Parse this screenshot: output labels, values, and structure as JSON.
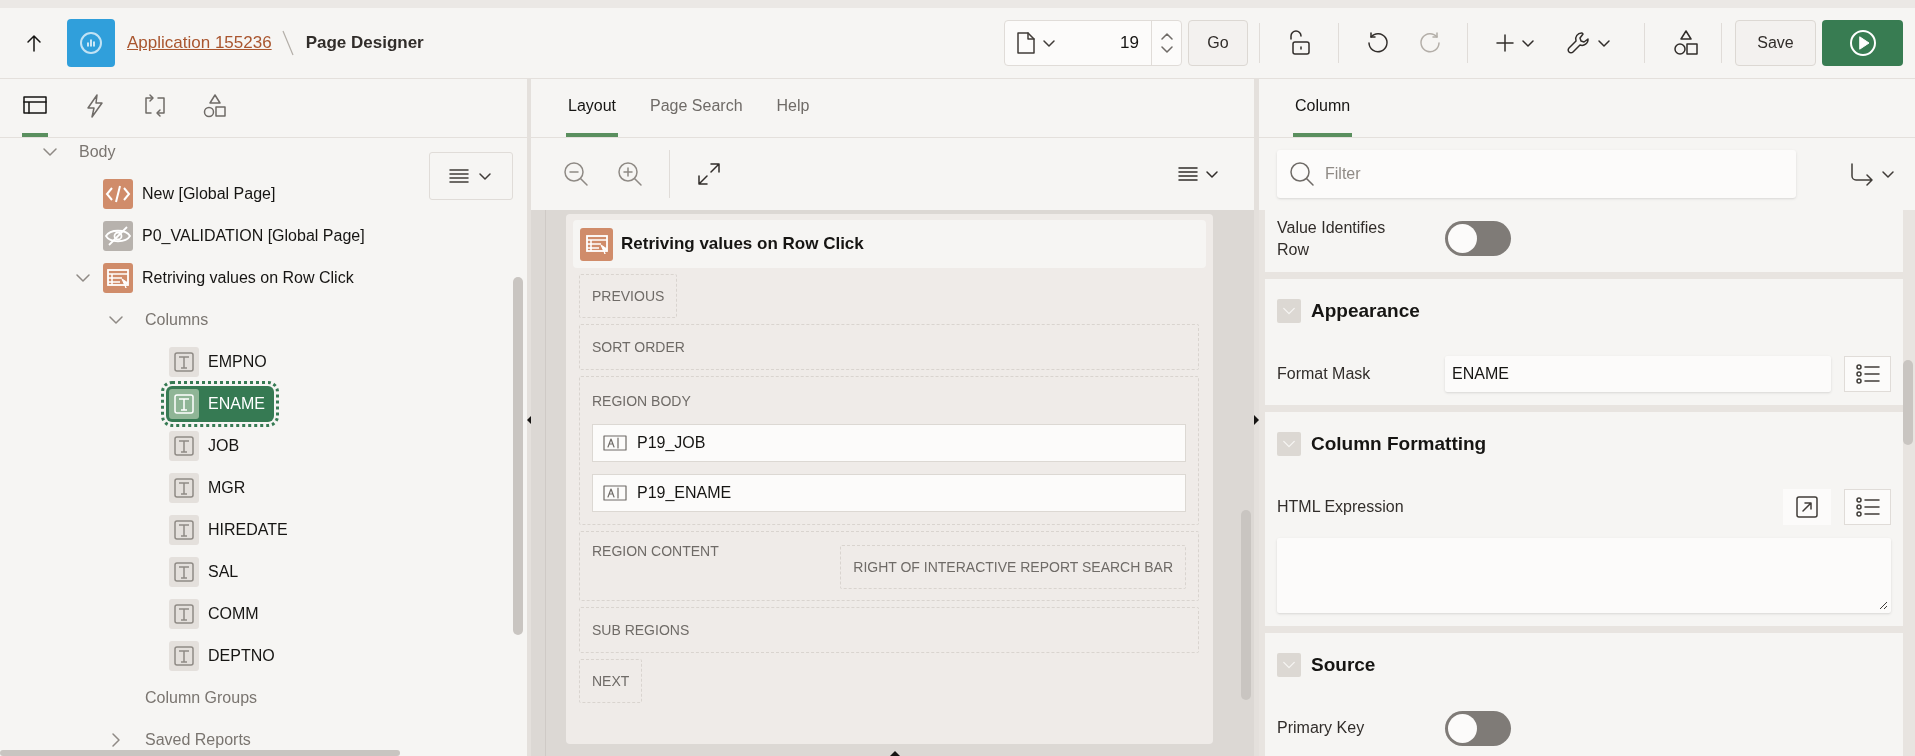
{
  "header": {
    "app_link": "Application 155236",
    "title": "Page Designer",
    "page_number": "19",
    "go_button": "Go",
    "save_button": "Save"
  },
  "left_panel": {
    "tabs": [
      {
        "kind": "rendering",
        "selected": true
      },
      {
        "kind": "dynamic-actions",
        "selected": false
      },
      {
        "kind": "processing",
        "selected": false
      },
      {
        "kind": "shared",
        "selected": false
      }
    ],
    "tree": [
      {
        "label": "Body",
        "expanded": true,
        "children": [
          {
            "label": "New [Global Page]",
            "kind": "code"
          },
          {
            "label": "P0_VALIDATION [Global Page]",
            "kind": "hidden"
          },
          {
            "label": "Retriving values on Row Click",
            "kind": "report",
            "expanded": true,
            "children": [
              {
                "label": "Columns",
                "expanded": true,
                "children": [
                  {
                    "label": "EMPNO",
                    "kind": "column",
                    "selected": false
                  },
                  {
                    "label": "ENAME",
                    "kind": "column",
                    "selected": true
                  },
                  {
                    "label": "JOB",
                    "kind": "column",
                    "selected": false
                  },
                  {
                    "label": "MGR",
                    "kind": "column",
                    "selected": false
                  },
                  {
                    "label": "HIREDATE",
                    "kind": "column",
                    "selected": false
                  },
                  {
                    "label": "SAL",
                    "kind": "column",
                    "selected": false
                  },
                  {
                    "label": "COMM",
                    "kind": "column",
                    "selected": false
                  },
                  {
                    "label": "DEPTNO",
                    "kind": "column",
                    "selected": false
                  }
                ]
              },
              {
                "label": "Column Groups"
              },
              {
                "label": "Saved Reports",
                "expanded": false
              }
            ]
          }
        ]
      }
    ]
  },
  "layout_panel": {
    "tabs": [
      {
        "label": "Layout",
        "selected": true
      },
      {
        "label": "Page Search",
        "selected": false
      },
      {
        "label": "Help",
        "selected": false
      }
    ],
    "region": {
      "title": "Retriving values on Row Click",
      "slots": [
        {
          "label": "PREVIOUS",
          "kind": "compact"
        },
        {
          "label": "SORT ORDER",
          "kind": "row"
        },
        {
          "label": "REGION BODY",
          "kind": "row",
          "items": [
            "P19_JOB",
            "P19_ENAME"
          ]
        },
        {
          "label": "REGION CONTENT",
          "kind": "row",
          "position": "RIGHT OF INTERACTIVE REPORT SEARCH BAR"
        },
        {
          "label": "SUB REGIONS",
          "kind": "row"
        },
        {
          "label": "NEXT",
          "kind": "compact"
        }
      ]
    }
  },
  "property_panel": {
    "tabs": [
      {
        "label": "Column",
        "selected": true
      }
    ],
    "filter": {
      "placeholder": "Filter"
    },
    "groups": [
      {
        "properties": [
          {
            "kind": "toggle",
            "label": "Value Identifies Row",
            "on": false
          }
        ]
      },
      {
        "title": "Appearance",
        "expanded": true,
        "properties": [
          {
            "kind": "text",
            "label": "Format Mask",
            "value": "ENAME"
          }
        ]
      },
      {
        "title": "Column Formatting",
        "expanded": true,
        "properties": [
          {
            "kind": "textarea",
            "label": "HTML Expression"
          }
        ]
      },
      {
        "title": "Source",
        "expanded": true,
        "properties": [
          {
            "kind": "toggle",
            "label": "Primary Key",
            "on": false
          }
        ]
      }
    ]
  }
}
